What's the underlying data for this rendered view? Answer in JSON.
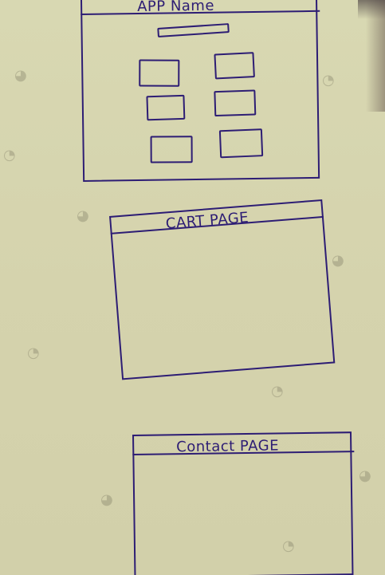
{
  "sketches": {
    "app": {
      "title": "APP Name"
    },
    "cart": {
      "title": "CART PAGE"
    },
    "contact": {
      "title": "Contact PAGE"
    }
  }
}
